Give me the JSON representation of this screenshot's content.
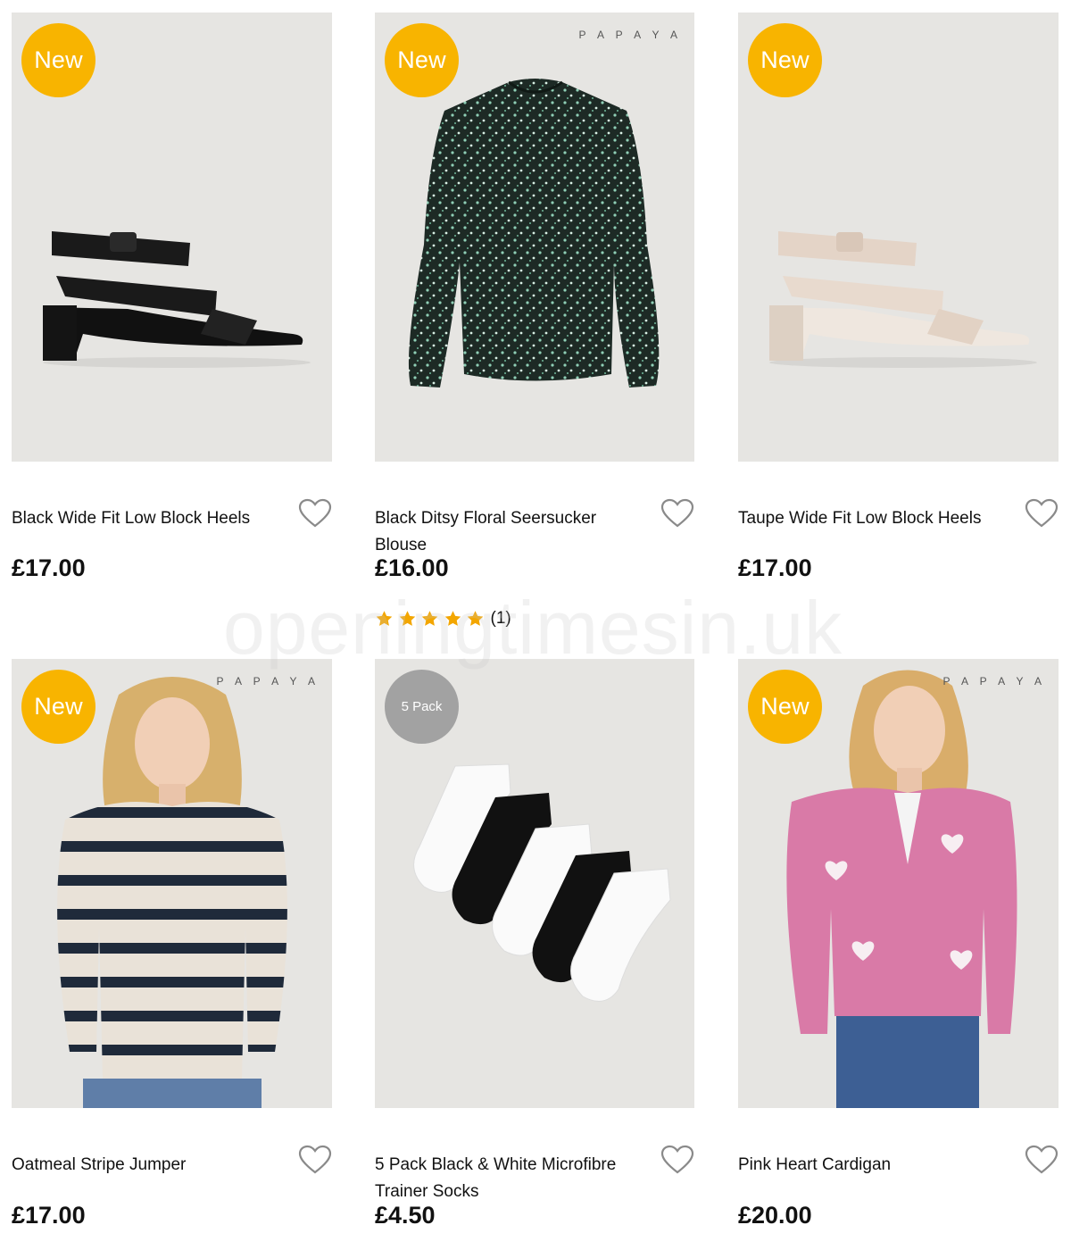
{
  "watermark": "openingtimesin.uk",
  "colors": {
    "badge_new": "#f8b400",
    "badge_pack": "#a2a2a2",
    "image_bg": "#e6e5e2",
    "star": "#f3a600"
  },
  "products": [
    {
      "title": "Black Wide Fit Low Block Heels",
      "price": "£17.00",
      "badge": "New",
      "brand": "",
      "image": "black-heel-sandal-image"
    },
    {
      "title": "Black Ditsy Floral Seersucker Blouse",
      "price": "£16.00",
      "badge": "New",
      "brand": "PAPAYA",
      "image": "floral-blouse-image",
      "rating": {
        "stars": 5,
        "count": "(1)"
      }
    },
    {
      "title": "Taupe Wide Fit Low Block Heels",
      "price": "£17.00",
      "badge": "New",
      "brand": "",
      "image": "taupe-heel-sandal-image"
    },
    {
      "title": "Oatmeal Stripe Jumper",
      "price": "£17.00",
      "badge": "New",
      "brand": "PAPAYA",
      "image": "stripe-jumper-model-image"
    },
    {
      "title": "5 Pack Black & White Microfibre Trainer Socks",
      "price": "£4.50",
      "badge": "5 Pack",
      "brand": "",
      "image": "trainer-socks-image"
    },
    {
      "title": "Pink Heart Cardigan",
      "price": "£20.00",
      "badge": "New",
      "brand": "PAPAYA",
      "image": "heart-cardigan-model-image"
    }
  ]
}
